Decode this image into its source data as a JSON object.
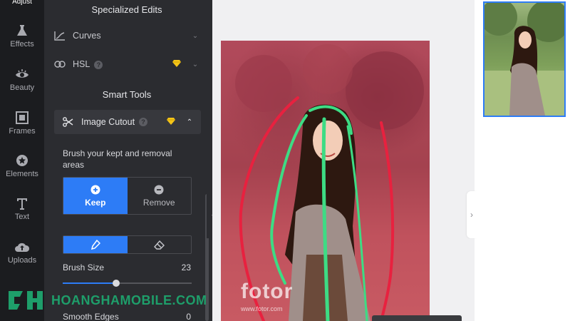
{
  "rail": {
    "top_label": "Adjust",
    "items": [
      {
        "label": "Effects",
        "icon": "flask-icon"
      },
      {
        "label": "Beauty",
        "icon": "eye-icon"
      },
      {
        "label": "Frames",
        "icon": "frame-icon"
      },
      {
        "label": "Elements",
        "icon": "star-icon"
      },
      {
        "label": "Text",
        "icon": "text-icon"
      },
      {
        "label": "Uploads",
        "icon": "cloud-upload-icon"
      }
    ]
  },
  "panel": {
    "specialized_title": "Specialized Edits",
    "curves_label": "Curves",
    "hsl_label": "HSL",
    "smart_tools_title": "Smart Tools",
    "cutout_label": "Image Cutout",
    "hint": "Brush your kept and removal areas",
    "keep_label": "Keep",
    "remove_label": "Remove",
    "brush_size_label": "Brush Size",
    "brush_size_value": "23",
    "brush_size_fraction": 0.23,
    "smooth_edges_label": "Smooth Edges",
    "smooth_edges_value": "0"
  },
  "canvas": {
    "watermark": "fotor",
    "watermark_url": "www.fotor.com"
  },
  "brand": {
    "text": "HOANGHAMOBILE.COM"
  },
  "colors": {
    "accent": "#2d7cf6",
    "premium": "#f5c518",
    "keep_stroke": "#3ddc84",
    "remove_stroke": "#e8213f",
    "brand": "#1e9e6a"
  }
}
